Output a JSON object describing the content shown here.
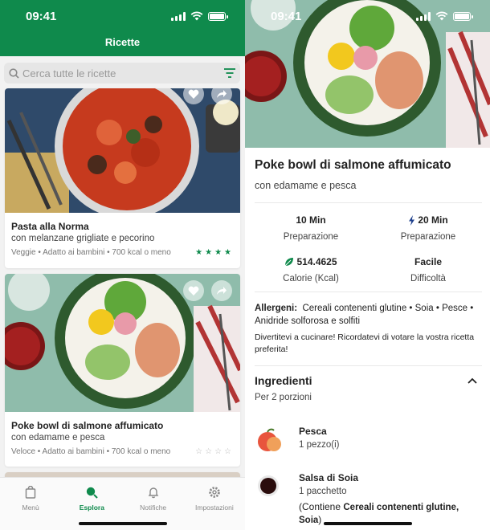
{
  "status_bar": {
    "time": "09:41"
  },
  "list_screen": {
    "header_title": "Ricette",
    "search": {
      "placeholder": "Cerca tutte le ricette"
    },
    "recipes": [
      {
        "title": "Pasta alla Norma",
        "subtitle": "con melanzane grigliate e pecorino",
        "tags": "Veggie • Adatto ai bambini • 700 kcal o meno",
        "rating": 4,
        "stars_text": "★★★★"
      },
      {
        "title": "Poke bowl  di salmone affumicato",
        "subtitle": "con edamame e pesca",
        "tags": "Veloce • Adatto ai bambini • 700 kcal o meno",
        "rating": 0,
        "stars_text": "☆☆☆☆"
      }
    ],
    "tabs": [
      {
        "label": "Menù",
        "icon": "bag-icon",
        "active": false
      },
      {
        "label": "Esplora",
        "icon": "explore-search-icon",
        "active": true
      },
      {
        "label": "Notifiche",
        "icon": "bell-icon",
        "active": false
      },
      {
        "label": "Impostazioni",
        "icon": "gear-icon",
        "active": false
      }
    ]
  },
  "detail_screen": {
    "title": "Poke bowl  di salmone affumicato",
    "subtitle": "con edamame e pesca",
    "stats": [
      {
        "value": "10 Min",
        "label": "Preparazione",
        "icon": ""
      },
      {
        "value": "20 Min",
        "label": "Preparazione",
        "icon": "bolt-icon"
      },
      {
        "value": "514.4625",
        "label": "Calorie (Kcal)",
        "icon": "leaf-icon"
      },
      {
        "value": "Facile",
        "label": "Difficoltà",
        "icon": ""
      }
    ],
    "allergens_label": "Allergeni:",
    "allergens_text": "Cereali contenenti glutine • Soia • Pesce • Anidride solforosa e solfiti",
    "note": "Divertitevi a cucinare! Ricordatevi di votare la vostra ricetta preferita!",
    "ingredients_title": "Ingredienti",
    "portions": "Per 2 porzioni",
    "ingredients": [
      {
        "name": "Pesca",
        "quantity": "1 pezzo(i)",
        "extra_prefix": "",
        "extra_bold": "",
        "extra_suffix": ""
      },
      {
        "name": "Salsa di Soia",
        "quantity": "1 pacchetto",
        "extra_prefix": "(Contiene ",
        "extra_bold": "Cereali contenenti glutine, Soia",
        "extra_suffix": ")"
      }
    ]
  },
  "colors": {
    "brand_green": "#0f8a4c",
    "hero_bg": "#8fbcab",
    "bowl": "#2e5a2e"
  }
}
